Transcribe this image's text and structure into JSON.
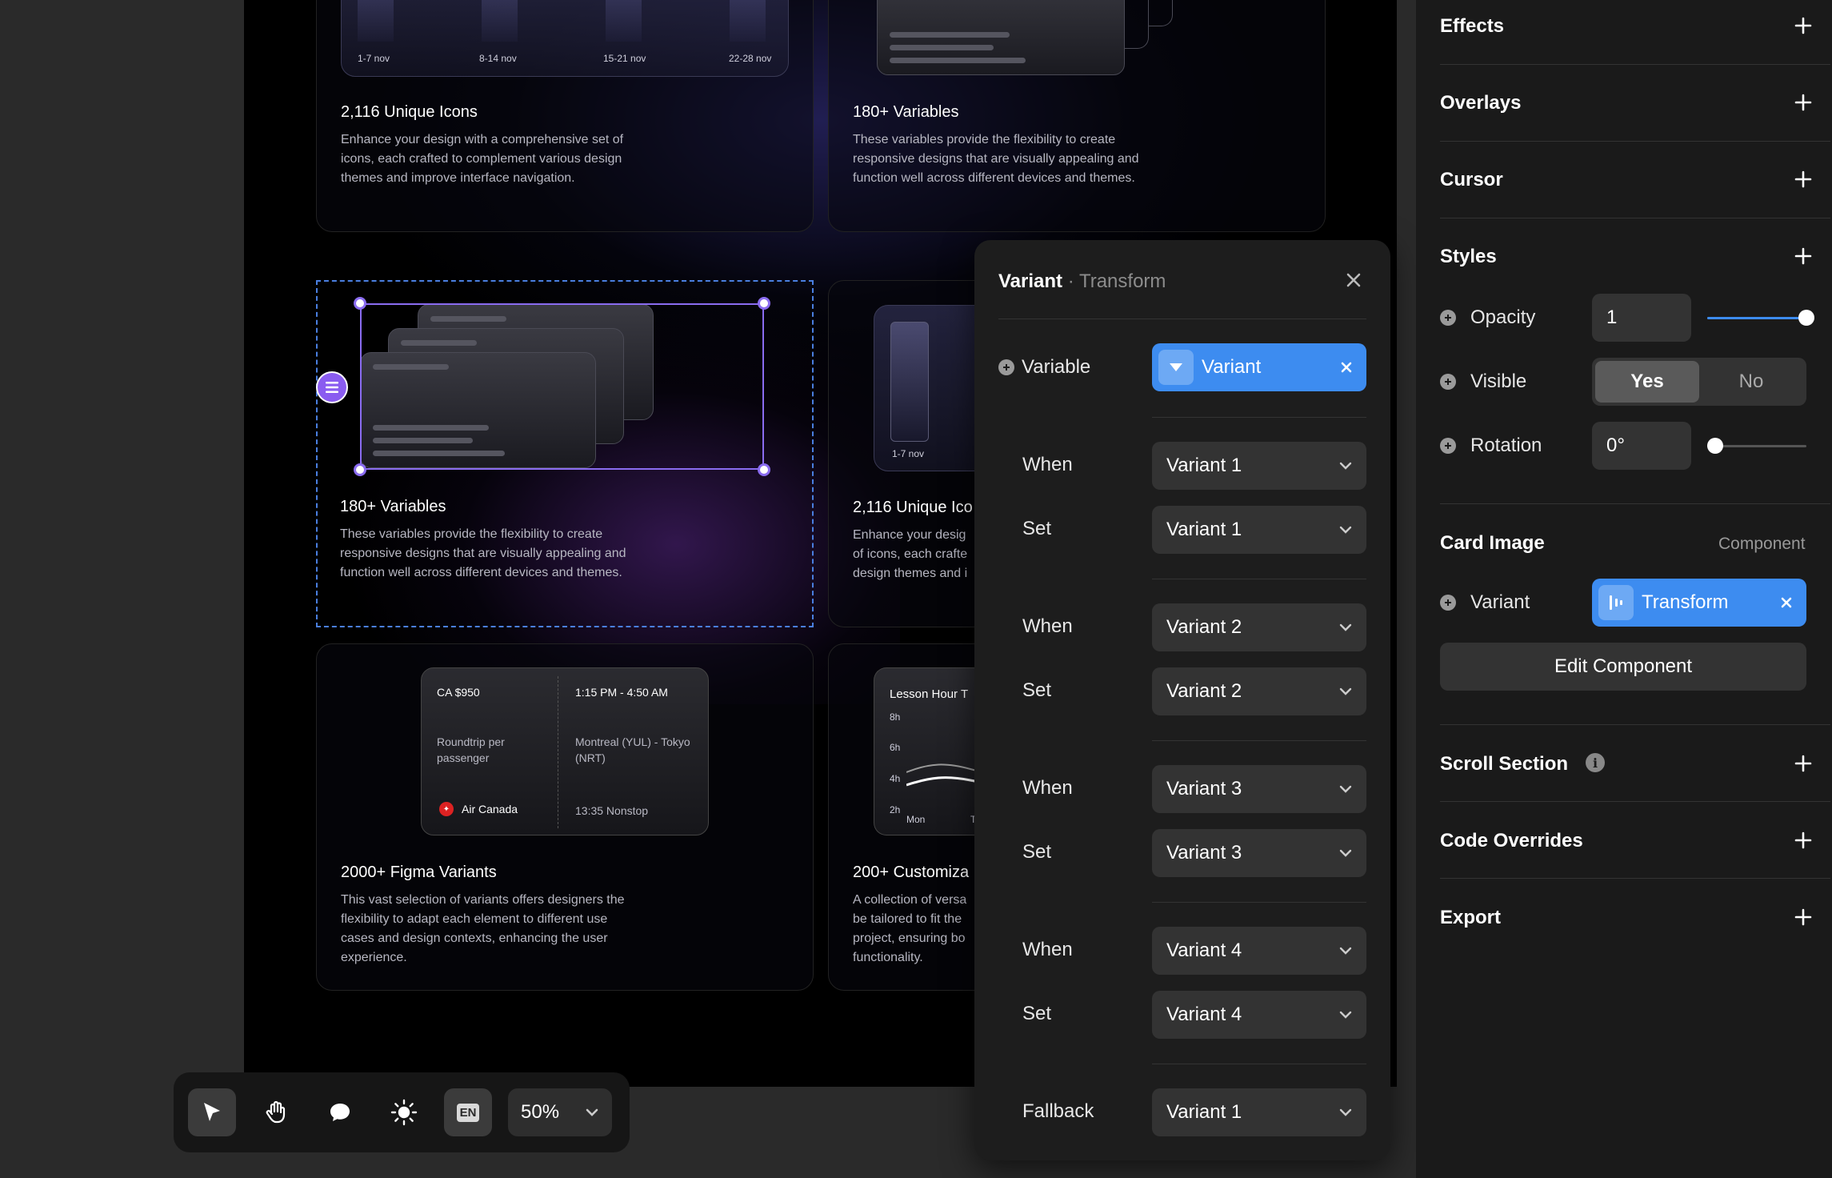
{
  "canvas": {
    "cards": [
      {
        "title": "2,116 Unique Icons",
        "desc": "Enhance your design with a comprehensive set of icons, each crafted to complement various design themes and improve interface navigation.",
        "ticks": [
          "1-7 nov",
          "8-14 nov",
          "15-21 nov",
          "22-28 nov"
        ]
      },
      {
        "title": "180+ Variables",
        "desc": "These variables provide the flexibility to create responsive designs that are visually appealing and function well across different devices and themes."
      },
      {
        "title": "180+ Variables",
        "desc": "These variables provide the flexibility to create responsive designs that are visually appealing and function well across different devices and themes."
      },
      {
        "title": "2,116 Unique Ico",
        "desc": "Enhance your desig of icons, each crafte design themes and i navigation.",
        "tick": "1-7 nov"
      },
      {
        "title": "2000+ Figma Variants",
        "desc": "This vast selection of variants offers designers the flexibility to adapt each element to different use cases and design contexts, enhancing the user experience."
      },
      {
        "title": "200+ Customiza",
        "desc": "A collection of versa be tailored to fit the project, ensuring bo functionality."
      }
    ],
    "flight": {
      "price": "CA $950",
      "time": "1:15 PM - 4:50 AM",
      "trip": "Roundtrip per passenger",
      "route": "Montreal (YUL) - Tokyo (NRT)",
      "airline": "Air Canada",
      "duration": "13:35 Nonstop"
    },
    "lesson": {
      "title": "Lesson Hour T",
      "y_ticks": [
        "8h",
        "6h",
        "4h",
        "2h"
      ],
      "x_ticks": [
        "Mon",
        "Tu"
      ]
    }
  },
  "toolbar": {
    "zoom": "50%",
    "lang": "EN"
  },
  "variant_panel": {
    "title": "Variant",
    "subtitle": "· Transform",
    "variable_label": "Variable",
    "variable_value": "Variant",
    "rules": [
      {
        "when_label": "When",
        "when": "Variant 1",
        "set_label": "Set",
        "set": "Variant 1"
      },
      {
        "when_label": "When",
        "when": "Variant 2",
        "set_label": "Set",
        "set": "Variant 2"
      },
      {
        "when_label": "When",
        "when": "Variant 3",
        "set_label": "Set",
        "set": "Variant 3"
      },
      {
        "when_label": "When",
        "when": "Variant 4",
        "set_label": "Set",
        "set": "Variant 4"
      }
    ],
    "fallback_label": "Fallback",
    "fallback": "Variant 1"
  },
  "sidebar": {
    "effects": "Effects",
    "overlays": "Overlays",
    "cursor": "Cursor",
    "styles": "Styles",
    "opacity_label": "Opacity",
    "opacity_value": "1",
    "opacity_level": 1.0,
    "visible_label": "Visible",
    "visible_yes": "Yes",
    "visible_no": "No",
    "rotation_label": "Rotation",
    "rotation_value": "0°",
    "rotation_level": 0,
    "card_image": "Card Image",
    "component": "Component",
    "variant_label": "Variant",
    "variant_value": "Transform",
    "edit_component": "Edit Component",
    "scroll_section": "Scroll Section",
    "code_overrides": "Code Overrides",
    "export": "Export"
  }
}
